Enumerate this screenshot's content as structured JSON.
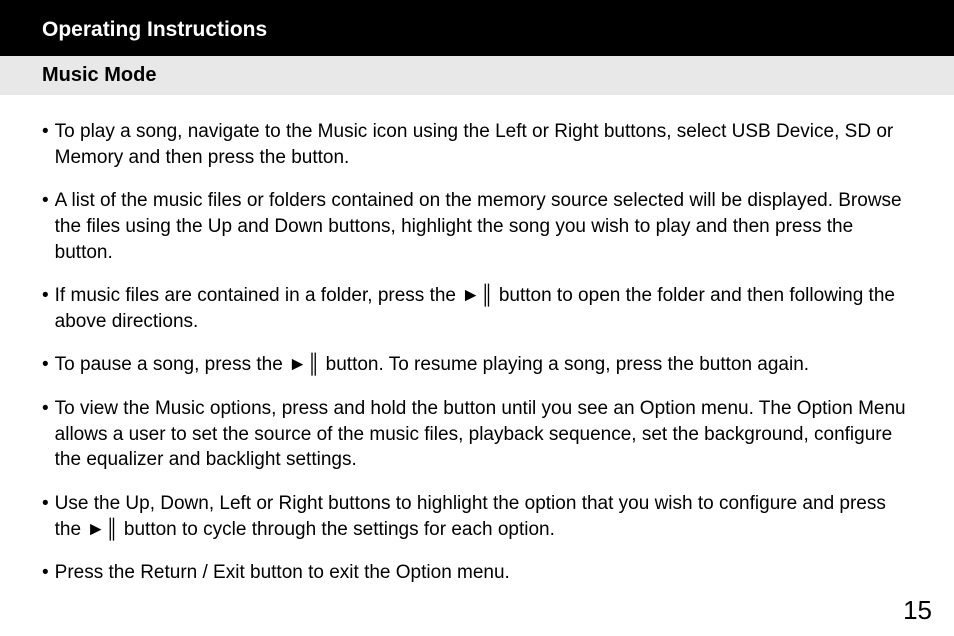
{
  "header": {
    "title": "Operating Instructions",
    "subtitle": "Music Mode"
  },
  "playPauseSymbol": "►║",
  "bullets": [
    {
      "parts": [
        {
          "type": "text",
          "value": "To play a song, navigate to the Music icon using the Left or Right buttons, select USB Device, SD or Memory and then press the  button."
        }
      ]
    },
    {
      "parts": [
        {
          "type": "text",
          "value": "A list of the music files or folders contained on the memory source selected will be displayed. Browse the files using the Up and Down buttons, highlight the song you wish to play and then press the  button."
        }
      ]
    },
    {
      "parts": [
        {
          "type": "text",
          "value": "If music files are contained in a folder, press the  "
        },
        {
          "type": "symbol"
        },
        {
          "type": "text",
          "value": "  button to open the folder and then following the above directions."
        }
      ]
    },
    {
      "parts": [
        {
          "type": "text",
          "value": "To pause a song, press the  "
        },
        {
          "type": "symbol"
        },
        {
          "type": "text",
          "value": "  button. To resume playing a song, press the  button again."
        }
      ]
    },
    {
      "parts": [
        {
          "type": "text",
          "value": "To view the Music options, press and hold the  button until you see an Option menu. The Option Menu allows a user to set the source of the music files, playback sequence, set the background, configure the equalizer and backlight settings."
        }
      ]
    },
    {
      "parts": [
        {
          "type": "text",
          "value": "Use the Up, Down, Left or Right buttons to highlight the option that you wish to configure and press the  "
        },
        {
          "type": "symbol"
        },
        {
          "type": "text",
          "value": "  button to cycle through the settings for each option."
        }
      ]
    },
    {
      "parts": [
        {
          "type": "text",
          "value": "Press the Return / Exit button to exit the Option menu."
        }
      ]
    }
  ],
  "pageNumber": "15"
}
